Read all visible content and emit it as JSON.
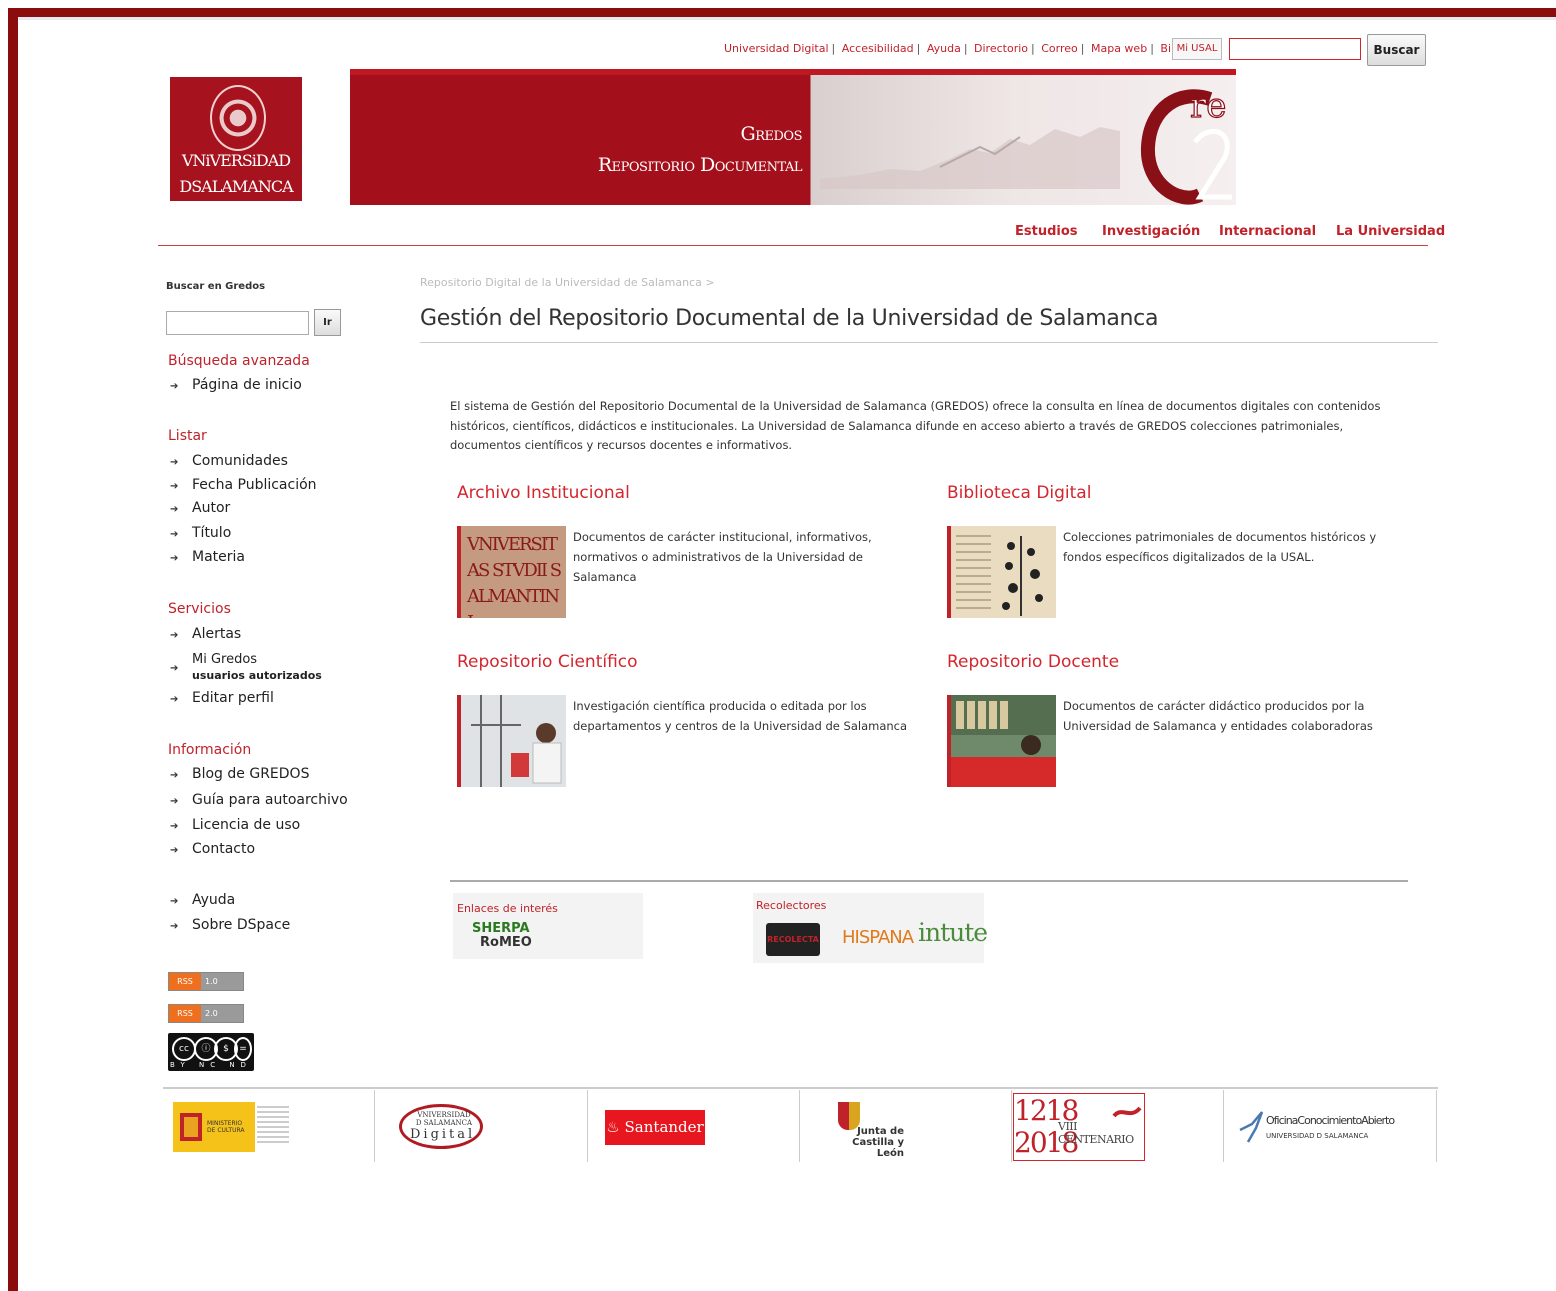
{
  "top_links": [
    "Universidad Digital",
    "Accesibilidad",
    "Ayuda",
    "Directorio",
    "Correo",
    "Mapa web",
    "Bibliotecas"
  ],
  "mi_usal": "Mi USAL",
  "top_search": {
    "value": "",
    "button": "Buscar"
  },
  "logo": {
    "line1": "VNiVERSiDAD",
    "line2": "DSALAMANCA"
  },
  "banner": {
    "title_line1": "Gredos",
    "title_line2": "Repositorio Documental",
    "mark": "re 2"
  },
  "main_nav": [
    "Estudios",
    "Investigación",
    "Internacional",
    "La Universidad"
  ],
  "sidebar": {
    "search_label": "Buscar en Gredos",
    "search_value": "",
    "search_button": "Ir",
    "advanced": "Búsqueda avanzada",
    "home": "Página de inicio",
    "listar_title": "Listar",
    "listar": [
      "Comunidades",
      "Fecha Publicación",
      "Autor",
      "Título",
      "Materia"
    ],
    "servicios_title": "Servicios",
    "alertas": "Alertas",
    "mi_gredos": "Mi Gredos",
    "mi_gredos_sub": "usuarios autorizados",
    "editar": "Editar perfil",
    "info_title": "Información",
    "info": [
      "Blog de GREDOS",
      "Guía para autoarchivo",
      "Licencia de uso",
      "Contacto"
    ],
    "extra": [
      "Ayuda",
      "Sobre DSpace"
    ],
    "rss1": {
      "left": "RSS",
      "right": "1.0"
    },
    "rss2": {
      "left": "RSS",
      "right": "2.0"
    },
    "cc": {
      "text": "BY NC ND"
    }
  },
  "breadcrumb": "Repositorio Digital de la Universidad de Salamanca >",
  "page_title": "Gestión del Repositorio Documental de la Universidad de Salamanca",
  "intro": "El sistema de Gestión del Repositorio Documental de la Universidad de Salamanca (GREDOS) ofrece la consulta en línea de documentos digitales con contenidos históricos, científicos, didácticos e institucionales. La Universidad de Salamanca difunde en acceso abierto a través de GREDOS colecciones patrimoniales, documentos científicos y recursos docentes e informativos.",
  "sections": [
    {
      "title": "Archivo Institucional",
      "desc": "Documentos de carácter institucional, informativos, normativos o administrativos de la Universidad de Salamanca",
      "thumb_text": "VNIVERSITAS STVDII SALMANTINI"
    },
    {
      "title": "Biblioteca Digital",
      "desc": "Colecciones patrimoniales de documentos históricos y fondos específicos digitalizados de la USAL."
    },
    {
      "title": "Repositorio Científico",
      "desc": "Investigación científica producida o editada por los departamentos y centros de la Universidad de Salamanca"
    },
    {
      "title": "Repositorio Docente",
      "desc": "Documentos de carácter didáctico producidos por la Universidad de Salamanca y entidades colaboradoras"
    }
  ],
  "links_box": {
    "label": "Enlaces de interés",
    "sherpa_1": "SHERPA",
    "sherpa_2": "RoMEO"
  },
  "harvesters": {
    "label": "Recolectores",
    "recolecta": "RECOLECTA",
    "hispana": "HISPANA",
    "intute": "intute"
  },
  "footer": {
    "ministry": "MINISTERIO DE CULTURA",
    "ud_top": "VNIVERSIDAD D SALAMANCA",
    "ud_bottom": "Digital",
    "santander": "Santander",
    "junta_1": "Junta de",
    "junta_2": "Castilla y León",
    "cent_y1": "1218",
    "cent_y2": "2018",
    "cent_text": "VIII CENTENARIO",
    "ocu_1": "OficinaConocimientoAbierto",
    "ocu_2": "UNIVERSIDAD D SALAMANCA"
  },
  "colors": {
    "brand_red": "#a6121d",
    "link_red": "#c0222a",
    "frame": "#8a0c0c"
  }
}
